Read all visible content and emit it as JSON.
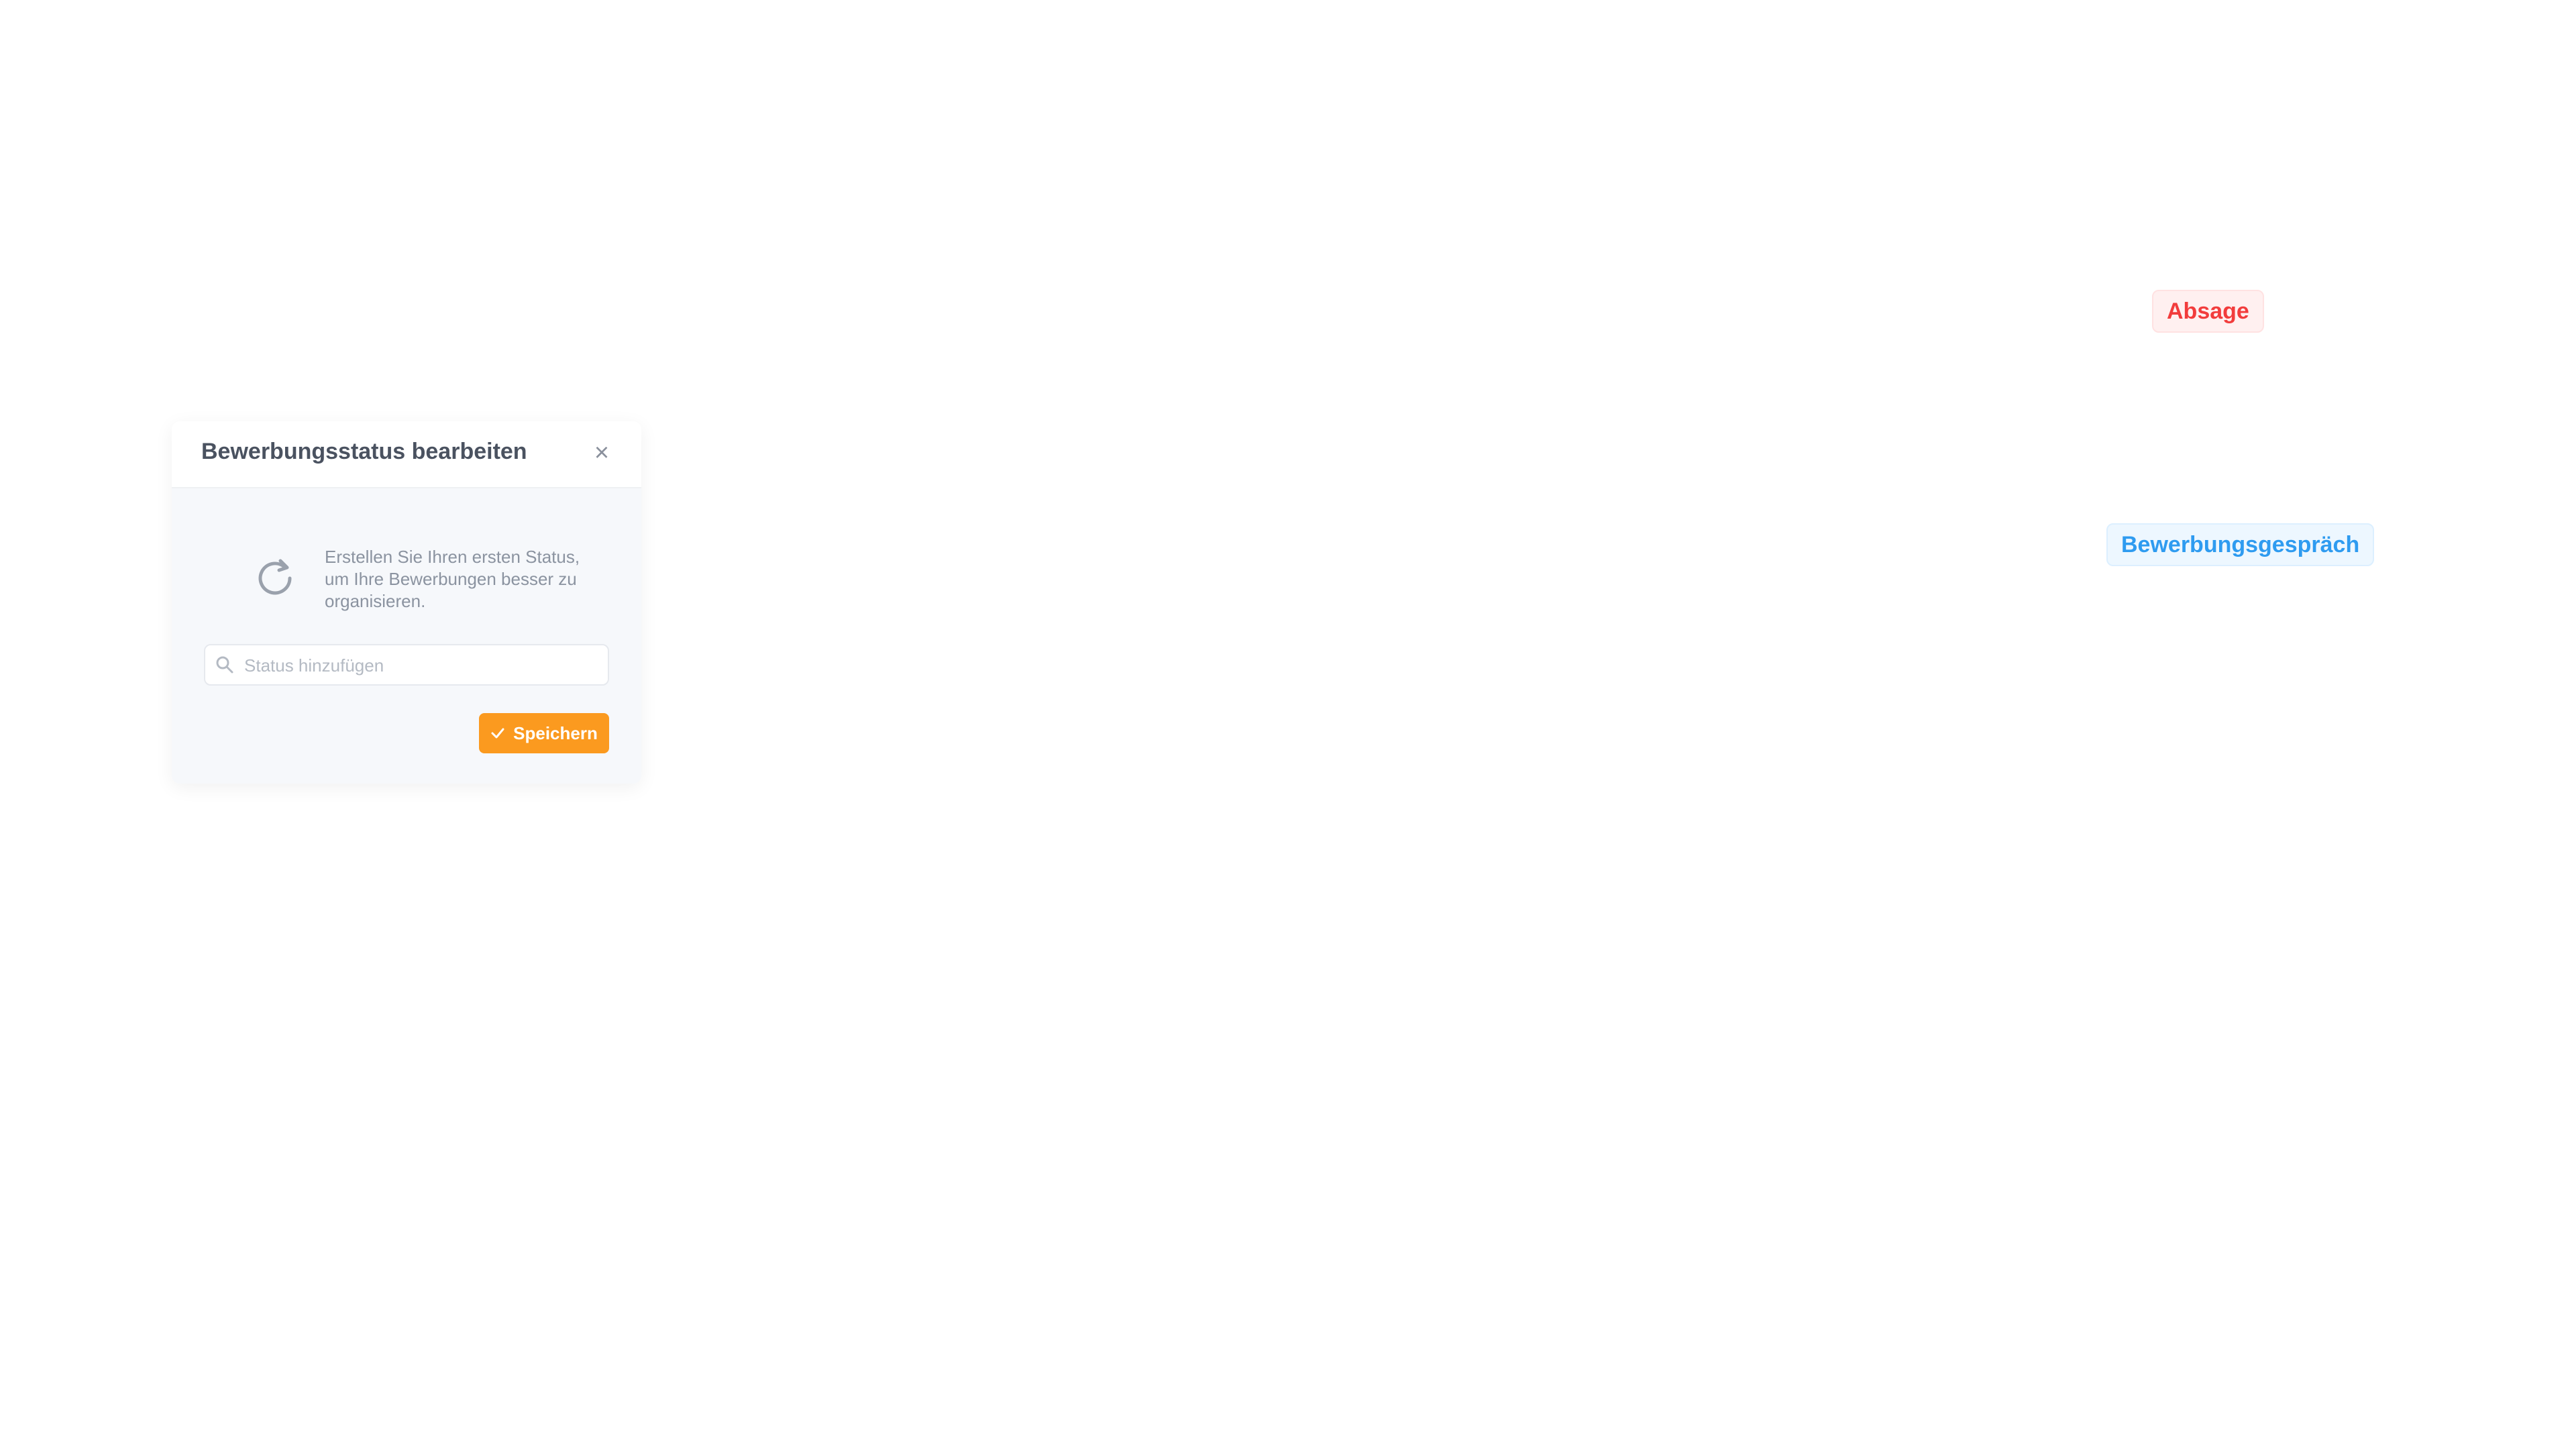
{
  "background_list": {
    "status_tags": [
      {
        "label": "Absage",
        "color": "#f23c3c"
      },
      {
        "label": "Bewerbungsgespräch",
        "color": "#2e9bf0"
      }
    ]
  },
  "popover": {
    "title": "Bewerbungsstatus bearbeiten",
    "close_label": "×",
    "info_text": "Erstellen Sie Ihren ersten Status, um Ihre Bewerbungen besser zu organisieren.",
    "search": {
      "placeholder": "Status hinzufügen",
      "value": ""
    },
    "submit_label": "Speichern"
  },
  "colors": {
    "accent": "#fb9a1f",
    "rejected": "#f23c3c",
    "interview": "#2e9bf0"
  },
  "icons": {
    "refresh": "refresh-icon",
    "search": "search-icon",
    "close": "close-icon",
    "check": "check-icon"
  }
}
